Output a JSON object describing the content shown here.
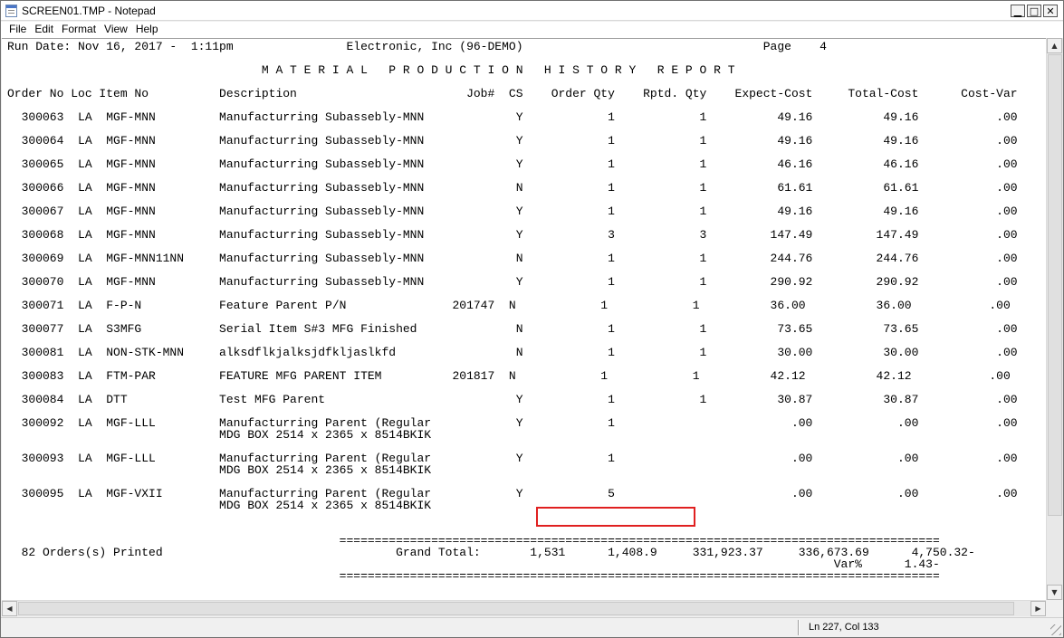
{
  "window": {
    "title": "SCREEN01.TMP - Notepad"
  },
  "menu": [
    "File",
    "Edit",
    "Format",
    "View",
    "Help"
  ],
  "document": {
    "lines": [
      "Run Date: Nov 16, 2017 -  1:11pm                Electronic, Inc (96-DEMO)                                  Page    4",
      "                                    M A T E R I A L   P R O D U C T I O N   H I S T O R Y   R E P O R T",
      "Order No Loc Item No          Description                        Job#  CS    Order Qty    Rptd. Qty    Expect-Cost     Total-Cost      Cost-Var",
      "  300063  LA  MGF-MNN         Manufacturring Subassebly-MNN             Y            1            1          49.16          49.16           .00",
      "  300064  LA  MGF-MNN         Manufacturring Subassebly-MNN             Y            1            1          49.16          49.16           .00",
      "  300065  LA  MGF-MNN         Manufacturring Subassebly-MNN             Y            1            1          46.16          46.16           .00",
      "  300066  LA  MGF-MNN         Manufacturring Subassebly-MNN             N            1            1          61.61          61.61           .00",
      "  300067  LA  MGF-MNN         Manufacturring Subassebly-MNN             Y            1            1          49.16          49.16           .00",
      "  300068  LA  MGF-MNN         Manufacturring Subassebly-MNN             Y            3            3         147.49         147.49           .00",
      "  300069  LA  MGF-MNN11NN     Manufacturring Subassebly-MNN             N            1            1         244.76         244.76           .00",
      "  300070  LA  MGF-MNN         Manufacturring Subassebly-MNN             Y            1            1         290.92         290.92           .00",
      "  300071  LA  F-P-N           Feature Parent P/N               201747  N            1            1          36.00          36.00           .00",
      "  300077  LA  S3MFG           Serial Item S#3 MFG Finished              N            1            1          73.65          73.65           .00",
      "  300081  LA  NON-STK-MNN     alksdflkjalksjdfkljaslkfd                 N            1            1          30.00          30.00           .00",
      "  300083  LA  FTM-PAR         FEATURE MFG PARENT ITEM          201817  N            1            1          42.12          42.12           .00",
      "  300084  LA  DTT             Test MFG Parent                           Y            1            1          30.87          30.87           .00",
      "  300092  LA  MGF-LLL         Manufacturring Parent (Regular            Y            1                         .00            .00           .00",
      "                              MDG BOX 2514 x 2365 x 8514BKIK",
      "  300093  LA  MGF-LLL         Manufacturring Parent (Regular            Y            1                         .00            .00           .00",
      "                              MDG BOX 2514 x 2365 x 8514BKIK",
      "  300095  LA  MGF-VXII        Manufacturring Parent (Regular            Y            5                         .00            .00           .00",
      "                              MDG BOX 2514 x 2365 x 8514BKIK",
      "                                               =====================================================================================",
      "  82 Orders(s) Printed                                 Grand Total:       1,531      1,408.9     331,923.37     336,673.69      4,750.32-",
      "                                                                                                                     Var%      1.43-",
      "                                               ====================================================================================="
    ]
  },
  "status": {
    "position": "Ln 227, Col 133"
  }
}
